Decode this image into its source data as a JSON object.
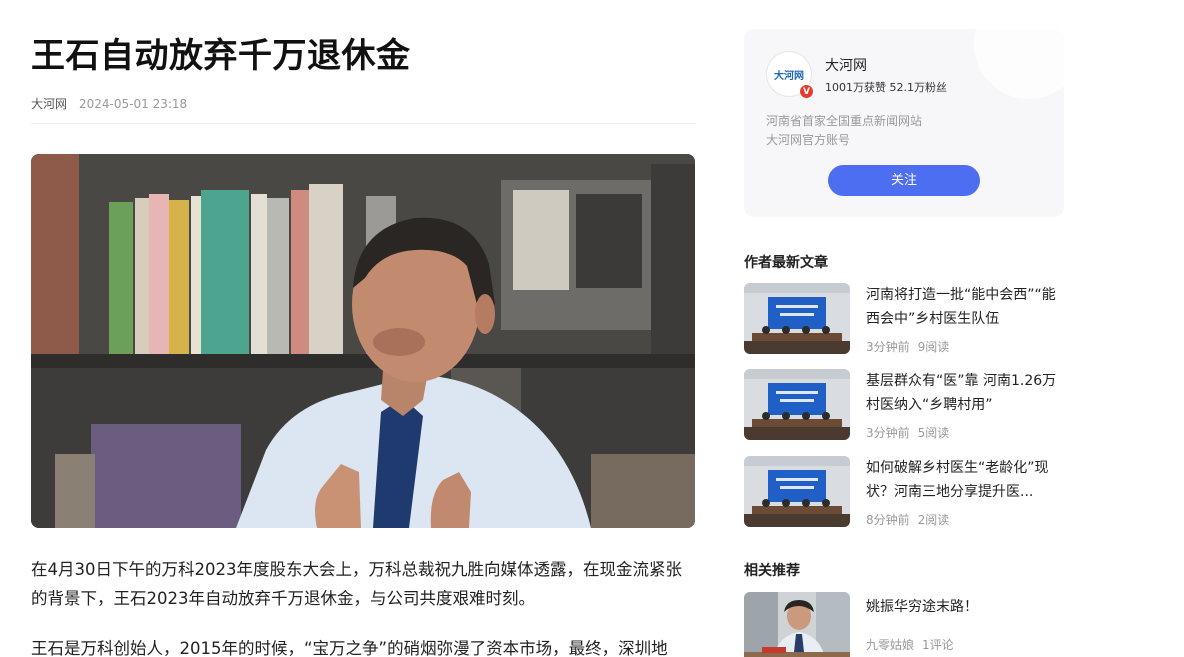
{
  "article": {
    "title": "王石自动放弃千万退休金",
    "source": "大河网",
    "date": "2024-05-01 23:18",
    "paragraphs": [
      "在4月30日下午的万科2023年度股东大会上，万科总裁祝九胜向媒体透露，在现金流紧张的背景下，王石2023年自动放弃千万退休金，与公司共度艰难时刻。",
      "王石是万科创始人，2015年的时候，“宝万之争”的硝烟弥漫了资本市场，最终，深圳地"
    ]
  },
  "author": {
    "logo_text": "大河网",
    "verified_badge": "V",
    "name": "大河网",
    "likes": "1001万获赞",
    "fans": "52.1万粉丝",
    "desc_line1": "河南省首家全国重点新闻网站",
    "desc_line2": "大河网官方账号",
    "follow_label": "关注"
  },
  "latest": {
    "title": "作者最新文章",
    "items": [
      {
        "title": "河南将打造一批“能中会西”“能西会中”乡村医生队伍",
        "time": "3分钟前",
        "reads": "9阅读"
      },
      {
        "title": "基层群众有“医”靠 河南1.26万村医纳入“乡聘村用”",
        "time": "3分钟前",
        "reads": "5阅读"
      },
      {
        "title": "如何破解乡村医生“老龄化”现状？河南三地分享提升医...",
        "time": "8分钟前",
        "reads": "2阅读"
      }
    ]
  },
  "related": {
    "title": "相关推荐",
    "items": [
      {
        "title": "姚振华穷途末路！",
        "author": "九零姑娘",
        "comments": "1评论"
      }
    ]
  },
  "colors": {
    "accent": "#4e6ef2",
    "card_bg": "#f7f7f9",
    "muted": "#999999",
    "badge": "#e33b2e"
  }
}
